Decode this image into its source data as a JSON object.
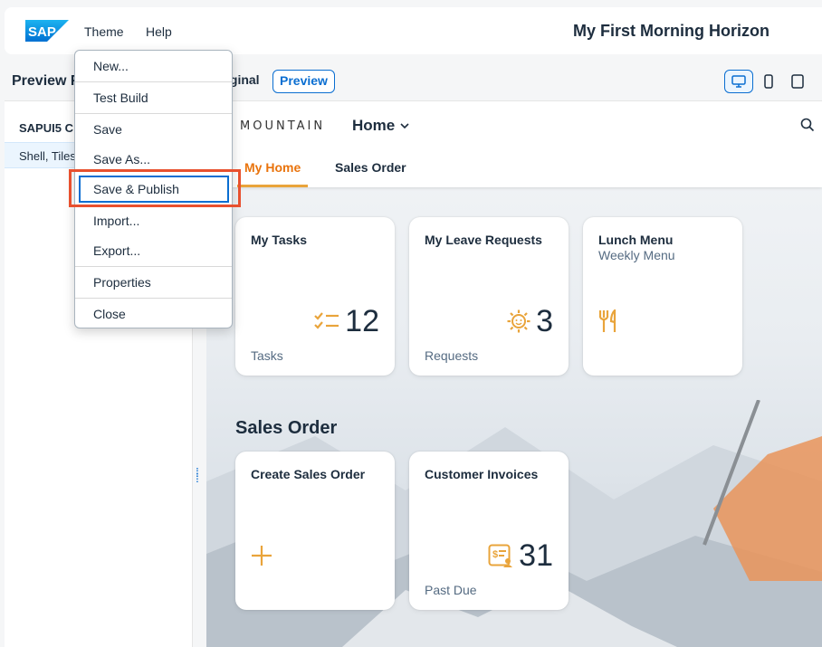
{
  "shell": {
    "logo_text": "SAP",
    "menu_theme": "Theme",
    "menu_help": "Help",
    "app_title": "My First Morning Horizon"
  },
  "left_panel": {
    "title": "Preview F",
    "group": "SAPUI5 C",
    "item": "Shell, Tiles"
  },
  "toolbar": {
    "original_label": "iginal",
    "preview_label": "Preview"
  },
  "dropdown": {
    "items": [
      "New...",
      "Test Build",
      "Save",
      "Save As...",
      "Save & Publish",
      "Import...",
      "Export...",
      "Properties",
      "Close"
    ]
  },
  "preview": {
    "brand": "MOUNTAIN",
    "home_nav": "Home",
    "tabs": [
      "My Home",
      "Sales Order"
    ],
    "tiles": [
      {
        "title": "My Tasks",
        "subtitle": "",
        "value": "12",
        "footer": "Tasks",
        "icon": "task-checklist-icon"
      },
      {
        "title": "My Leave Requests",
        "subtitle": "",
        "value": "3",
        "footer": "Requests",
        "icon": "sun-icon"
      },
      {
        "title": "Lunch Menu",
        "subtitle": "Weekly Menu",
        "value": "",
        "footer": "",
        "icon": "fork-knife-icon"
      }
    ],
    "section_title": "Sales Order",
    "sales_tiles": [
      {
        "title": "Create Sales Order",
        "value": "",
        "footer": "",
        "icon": "plus-icon"
      },
      {
        "title": "Customer Invoices",
        "value": "31",
        "footer": "Past Due",
        "icon": "invoice-icon"
      }
    ]
  },
  "colors": {
    "accent": "#0a6ed1",
    "highlight": "#e8502e",
    "kpi_icon": "#e9a43b"
  }
}
